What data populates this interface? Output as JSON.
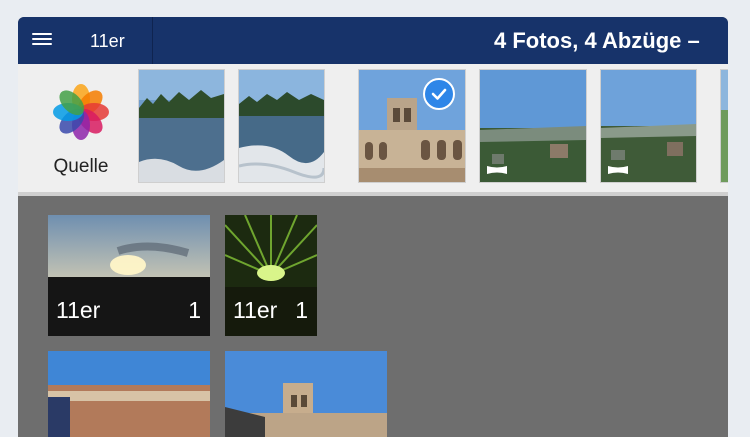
{
  "header": {
    "breadcrumb": "11er",
    "title": "4 Fotos, 4 Abzüge – "
  },
  "source": {
    "label": "Quelle",
    "icon": "photos-app-icon"
  },
  "source_thumbnails": [
    {
      "scene": "lake-trees",
      "selected": false
    },
    {
      "scene": "lake-wake",
      "selected": false
    },
    {
      "scene": "palace-tower",
      "selected": true
    },
    {
      "scene": "panorama-view",
      "selected": false,
      "panorama": true
    },
    {
      "scene": "panorama-city",
      "selected": false,
      "panorama": true
    }
  ],
  "prints": [
    {
      "format": "11er",
      "count": "1",
      "scene": "sunset"
    },
    {
      "format": "11er",
      "count": "1",
      "scene": "green-tunnel"
    },
    {
      "scene": "courtyard"
    },
    {
      "scene": "tower"
    }
  ],
  "colors": {
    "header": "#17336a",
    "accent_check": "#2e86e8",
    "canvas": "#6e6e6e"
  }
}
